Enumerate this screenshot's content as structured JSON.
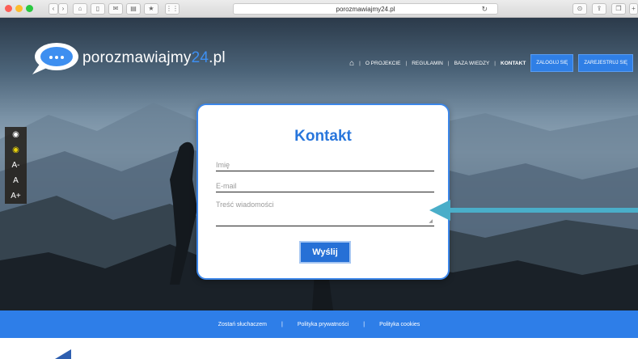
{
  "browser": {
    "url": "porozmawiajmy24.pl"
  },
  "logo": {
    "text_main": "porozmawiajmy",
    "text_accent": "24",
    "text_suffix": ".pl",
    "bubble_dots": "..."
  },
  "nav": {
    "items": [
      {
        "label": "O PROJEKCIE"
      },
      {
        "label": "REGULAMIN"
      },
      {
        "label": "BAZA WIEDZY"
      },
      {
        "label": "KONTAKT"
      }
    ],
    "login": "ZALOGUJ SIĘ",
    "register": "ZAREJESTRUJ SIĘ"
  },
  "a11y": {
    "font_decrease": "A-",
    "font_normal": "A",
    "font_increase": "A+"
  },
  "contact": {
    "title": "Kontakt",
    "name_placeholder": "Imię",
    "email_placeholder": "E-mail",
    "message_placeholder": "Treść wiadomości",
    "submit": "Wyślij"
  },
  "footer": {
    "links": [
      "Zostań słuchaczem",
      "Polityka prywatności",
      "Polityka cookies"
    ],
    "separator": "|"
  },
  "colors": {
    "brand_blue": "#2e7ee8",
    "accent_yellow": "#e8d20a",
    "arrow_teal": "#4aaec9"
  }
}
